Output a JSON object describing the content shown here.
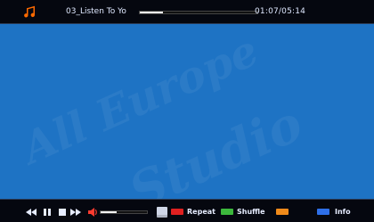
{
  "player": {
    "track_title": "03_Listen To Yo",
    "progress": 0.2,
    "time": "01:07/05:14"
  },
  "watermark": {
    "line1": "All Europe",
    "line2": "Studio"
  },
  "bottom": {
    "volume_level": 0.35,
    "keys": [
      {
        "label": "Repeat",
        "color": "#e02020"
      },
      {
        "label": "Shuffle",
        "color": "#3cb83c"
      },
      {
        "label": "",
        "color": "#f08a1a"
      },
      {
        "label": "Info",
        "color": "#2e6fe8"
      }
    ],
    "icons": [
      "rewind-icon",
      "pause-icon",
      "stop-icon",
      "fast-forward-icon",
      "volume-icon",
      "save-icon"
    ]
  },
  "colors": {
    "background": "#1e73c4",
    "bars": "#05070f",
    "accent_music": "#ff6a00",
    "accent_red": "#ff3b2f"
  }
}
